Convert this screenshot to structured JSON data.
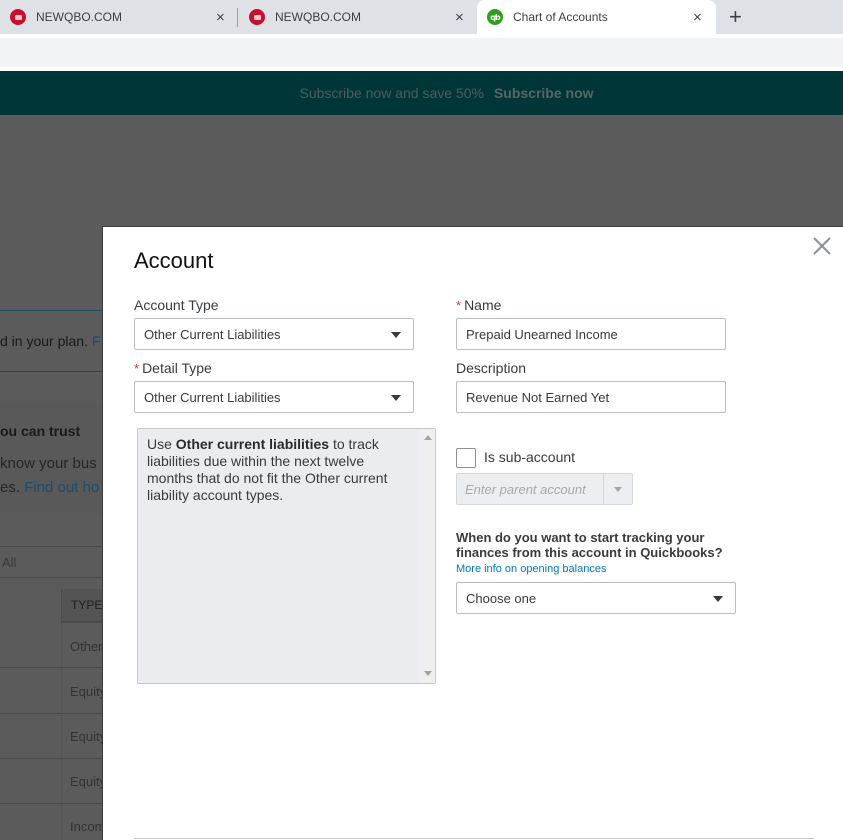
{
  "browser": {
    "tabs": [
      {
        "title": "NEWQBO.COM",
        "favicon": "newqbo-favicon",
        "active": false
      },
      {
        "title": "NEWQBO.COM",
        "favicon": "newqbo-favicon",
        "active": false
      },
      {
        "title": "Chart of Accounts",
        "favicon": "quickbooks-favicon",
        "active": true
      }
    ],
    "new_tab_icon": "+",
    "close_icon": "×"
  },
  "banner": {
    "text": "Subscribe now and save 50%",
    "cta": "Subscribe now"
  },
  "background_page": {
    "plan_text": "d in your plan. ",
    "plan_link": "F",
    "trust_title": "ou can trust",
    "trust_line1": "know your bus",
    "trust_line2_prefix": "es. ",
    "trust_link": "Find out ho",
    "filter_all": "All",
    "table_header_type": "TYPE",
    "table_rows": [
      "Other",
      "Equity",
      "Equity",
      "Equity",
      "Income"
    ]
  },
  "modal": {
    "title": "Account",
    "account_type": {
      "label": "Account Type",
      "value": "Other Current Liabilities"
    },
    "detail_type": {
      "required_mark": "*",
      "label": "Detail Type",
      "value": "Other Current Liabilities"
    },
    "name": {
      "required_mark": "*",
      "label": "Name",
      "value": "Prepaid Unearned Income"
    },
    "description": {
      "label": "Description",
      "value": "Revenue Not Earned Yet"
    },
    "detail_help": {
      "prefix": "Use ",
      "bold": "Other current liabilities",
      "suffix": " to track liabilities due within the next twelve months that do not fit the Other current liability account types."
    },
    "sub_account": {
      "label": "Is sub-account",
      "checked": false,
      "parent_placeholder": "Enter parent account"
    },
    "tracking": {
      "question": "When do you want to start tracking your finances from this account in Quickbooks?",
      "link": "More info on opening balances",
      "value": "Choose one"
    },
    "colors": {
      "required": "#e0341a",
      "link": "#0077c5",
      "banner_bg": "#013639"
    }
  }
}
